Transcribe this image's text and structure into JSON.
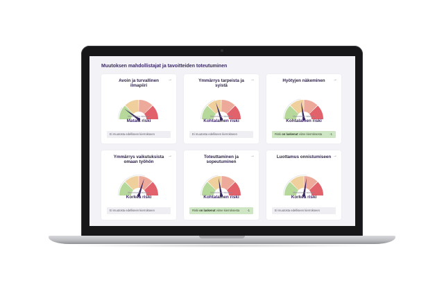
{
  "page": {
    "title": "Muutoksen mahdollistajat ja tavoitteiden toteutuminen"
  },
  "gauge_caption": "Muutoksen riskitaso",
  "colors": {
    "zone1": "#b6d89a",
    "zone2": "#efcf9b",
    "zone3": "#eda99a",
    "zone4": "#e2626b",
    "needle": "#3a2863",
    "note_neutral": "#efeef2",
    "note_green": "#cfe6c4"
  },
  "cards": [
    {
      "title": "Avoin ja turvallinen ilmapiiri",
      "risk": "Matala riski",
      "level": 0.2,
      "note": "Ei muutosta edelliseen kierrokseen",
      "note_kind": "neutral",
      "arrow_icon": "arrow-right-icon"
    },
    {
      "title": "Ymmärrys tarpeista ja syistä",
      "risk": "Kohtalainen riski",
      "level": 0.4,
      "note": "Ei muutosta edelliseen kierrokseen",
      "note_kind": "neutral",
      "arrow_icon": "arrow-right-icon"
    },
    {
      "title": "Hyötyjen näkeminen",
      "risk": "Kohtalainen riski",
      "level": 0.45,
      "note_prefix": "Riski",
      "note_bold": "on laskenut",
      "note_suffix": "viime kierroksesta",
      "note_delta": "-1",
      "note_kind": "green",
      "arrow_icon": "arrow-right-icon"
    },
    {
      "title": "Ymmärrys vaikutuksista omaan työhön",
      "risk": "Korkea riski",
      "level": 0.6,
      "note": "Ei muutosta edelliseen kierrokseen",
      "note_kind": "neutral",
      "arrow_icon": "arrow-right-icon"
    },
    {
      "title": "Toteuttaminen ja sopeutuminen",
      "risk": "Kohtalainen riski",
      "level": 0.45,
      "note_prefix": "Riski",
      "note_bold": "on laskenut",
      "note_suffix": "viime kierroksesta",
      "note_delta": "-1",
      "note_kind": "green",
      "arrow_icon": "arrow-right-icon"
    },
    {
      "title": "Luottamus onnistumiseen",
      "risk": "Korkea riski",
      "level": 0.55,
      "note": "Ei muutosta edelliseen kierrokseen",
      "note_kind": "neutral",
      "arrow_icon": "arrow-right-icon"
    }
  ]
}
